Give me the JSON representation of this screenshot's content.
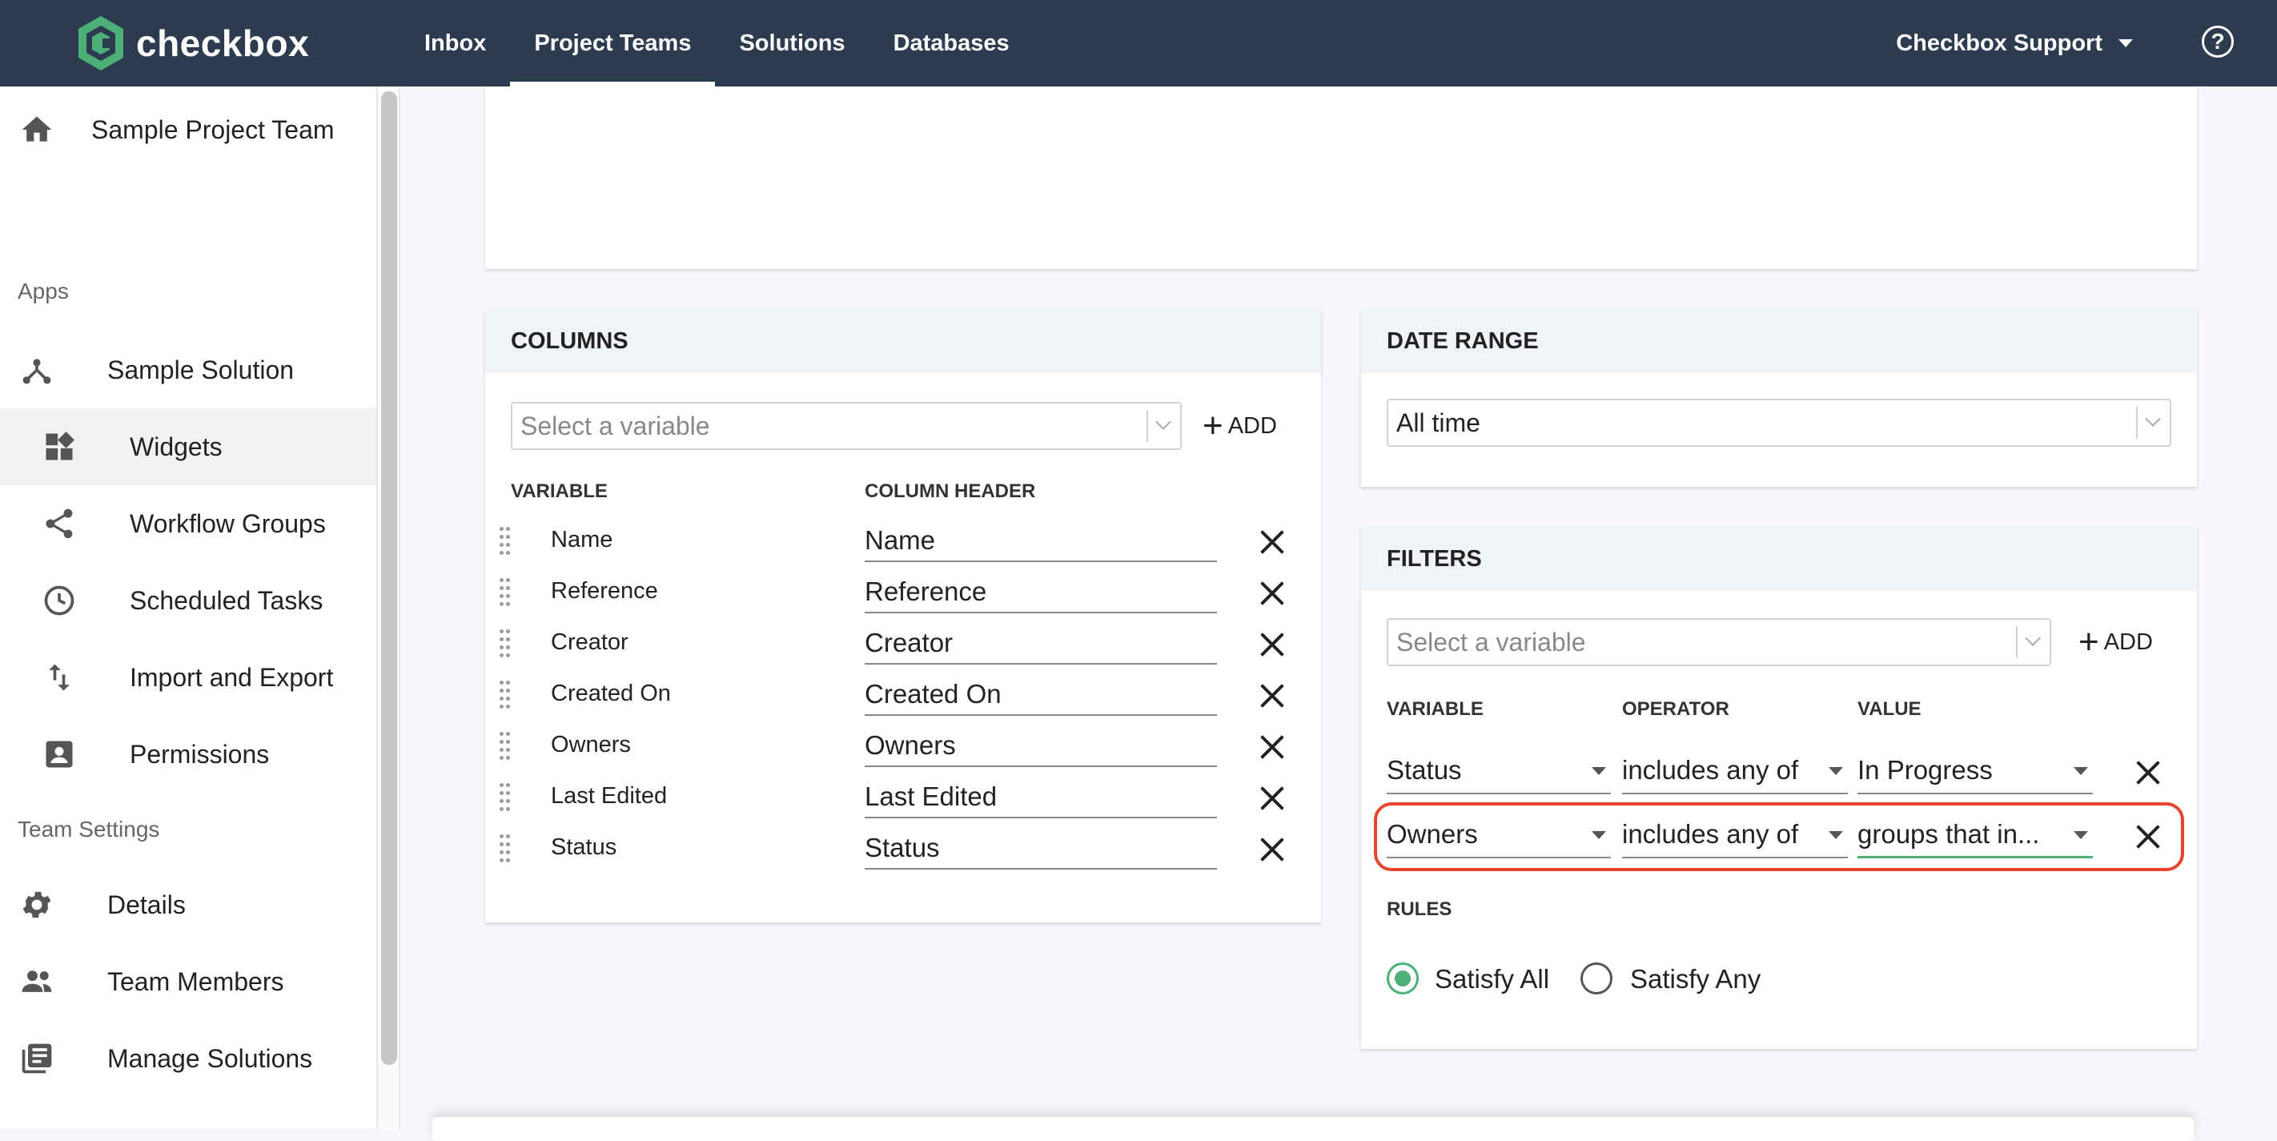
{
  "app": {
    "name": "checkbox"
  },
  "nav": {
    "items": [
      "Inbox",
      "Project Teams",
      "Solutions",
      "Databases"
    ],
    "active": "Project Teams"
  },
  "user": {
    "name": "Checkbox Support"
  },
  "sidebar": {
    "team": "Sample Project Team",
    "apps_section": "Apps",
    "solution": "Sample Solution",
    "items": [
      "Widgets",
      "Workflow Groups",
      "Scheduled Tasks",
      "Import and Export",
      "Permissions"
    ],
    "selected": "Widgets",
    "team_settings_section": "Team Settings",
    "settings_items": [
      "Details",
      "Team Members",
      "Manage Solutions"
    ]
  },
  "columns": {
    "title": "COLUMNS",
    "select_placeholder": "Select a variable",
    "add_label": "ADD",
    "header_variable": "VARIABLE",
    "header_column": "COLUMN HEADER",
    "rows": [
      {
        "variable": "Name",
        "header": "Name"
      },
      {
        "variable": "Reference",
        "header": "Reference"
      },
      {
        "variable": "Creator",
        "header": "Creator"
      },
      {
        "variable": "Created On",
        "header": "Created On"
      },
      {
        "variable": "Owners",
        "header": "Owners"
      },
      {
        "variable": "Last Edited",
        "header": "Last Edited"
      },
      {
        "variable": "Status",
        "header": "Status"
      }
    ]
  },
  "date_range": {
    "title": "DATE RANGE",
    "value": "All time"
  },
  "filters": {
    "title": "FILTERS",
    "select_placeholder": "Select a variable",
    "add_label": "ADD",
    "header_variable": "VARIABLE",
    "header_operator": "OPERATOR",
    "header_value": "VALUE",
    "rows": [
      {
        "variable": "Status",
        "operator": "includes any of",
        "value": "In Progress"
      },
      {
        "variable": "Owners",
        "operator": "includes any of",
        "value": "groups that in..."
      }
    ],
    "rules_label": "RULES",
    "rule_all": "Satisfy All",
    "rule_any": "Satisfy Any",
    "selected_rule": "Satisfy All"
  },
  "colors": {
    "topbar": "#2d3b4e",
    "accent": "#4caf78",
    "highlight": "#e8432e"
  }
}
